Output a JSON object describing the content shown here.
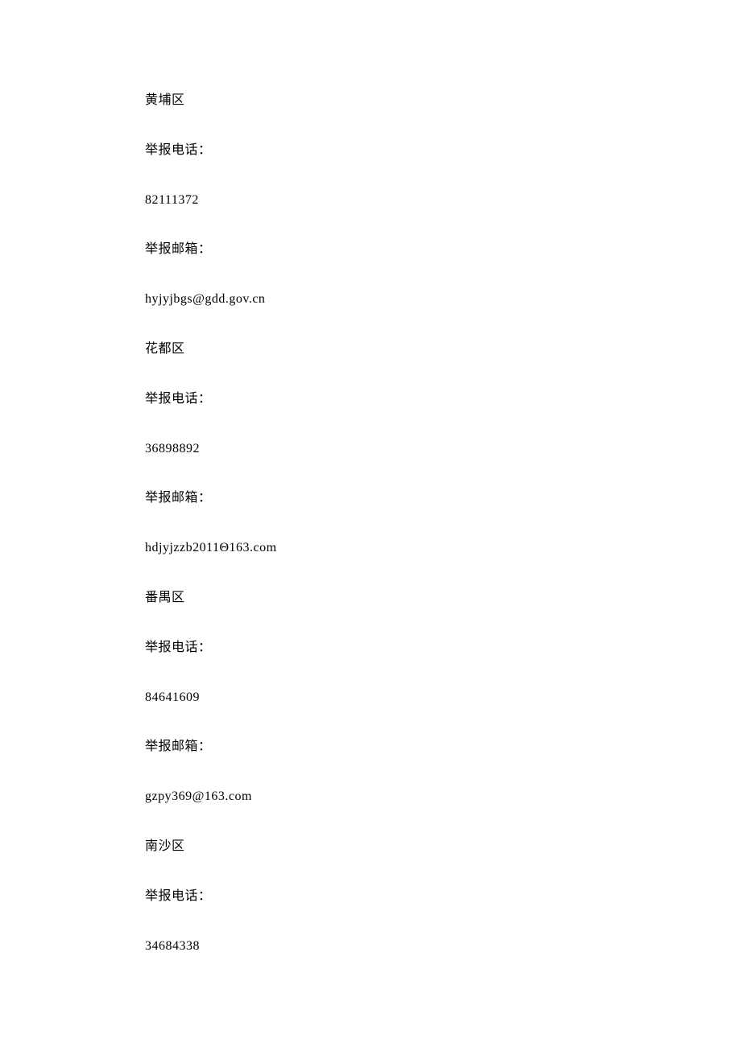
{
  "lines": [
    "黄埔区",
    "举报电话：",
    "82111372",
    "举报邮箱：",
    "hyjyjbgs@gdd.gov.cn",
    "花都区",
    "举报电话：",
    "36898892",
    "举报邮箱：",
    "hdjyjzzb2011Θ163.com",
    "番禺区",
    "举报电话：",
    "84641609",
    "举报邮箱：",
    "gzpy369@163.com",
    "南沙区",
    "举报电话：",
    "34684338"
  ]
}
